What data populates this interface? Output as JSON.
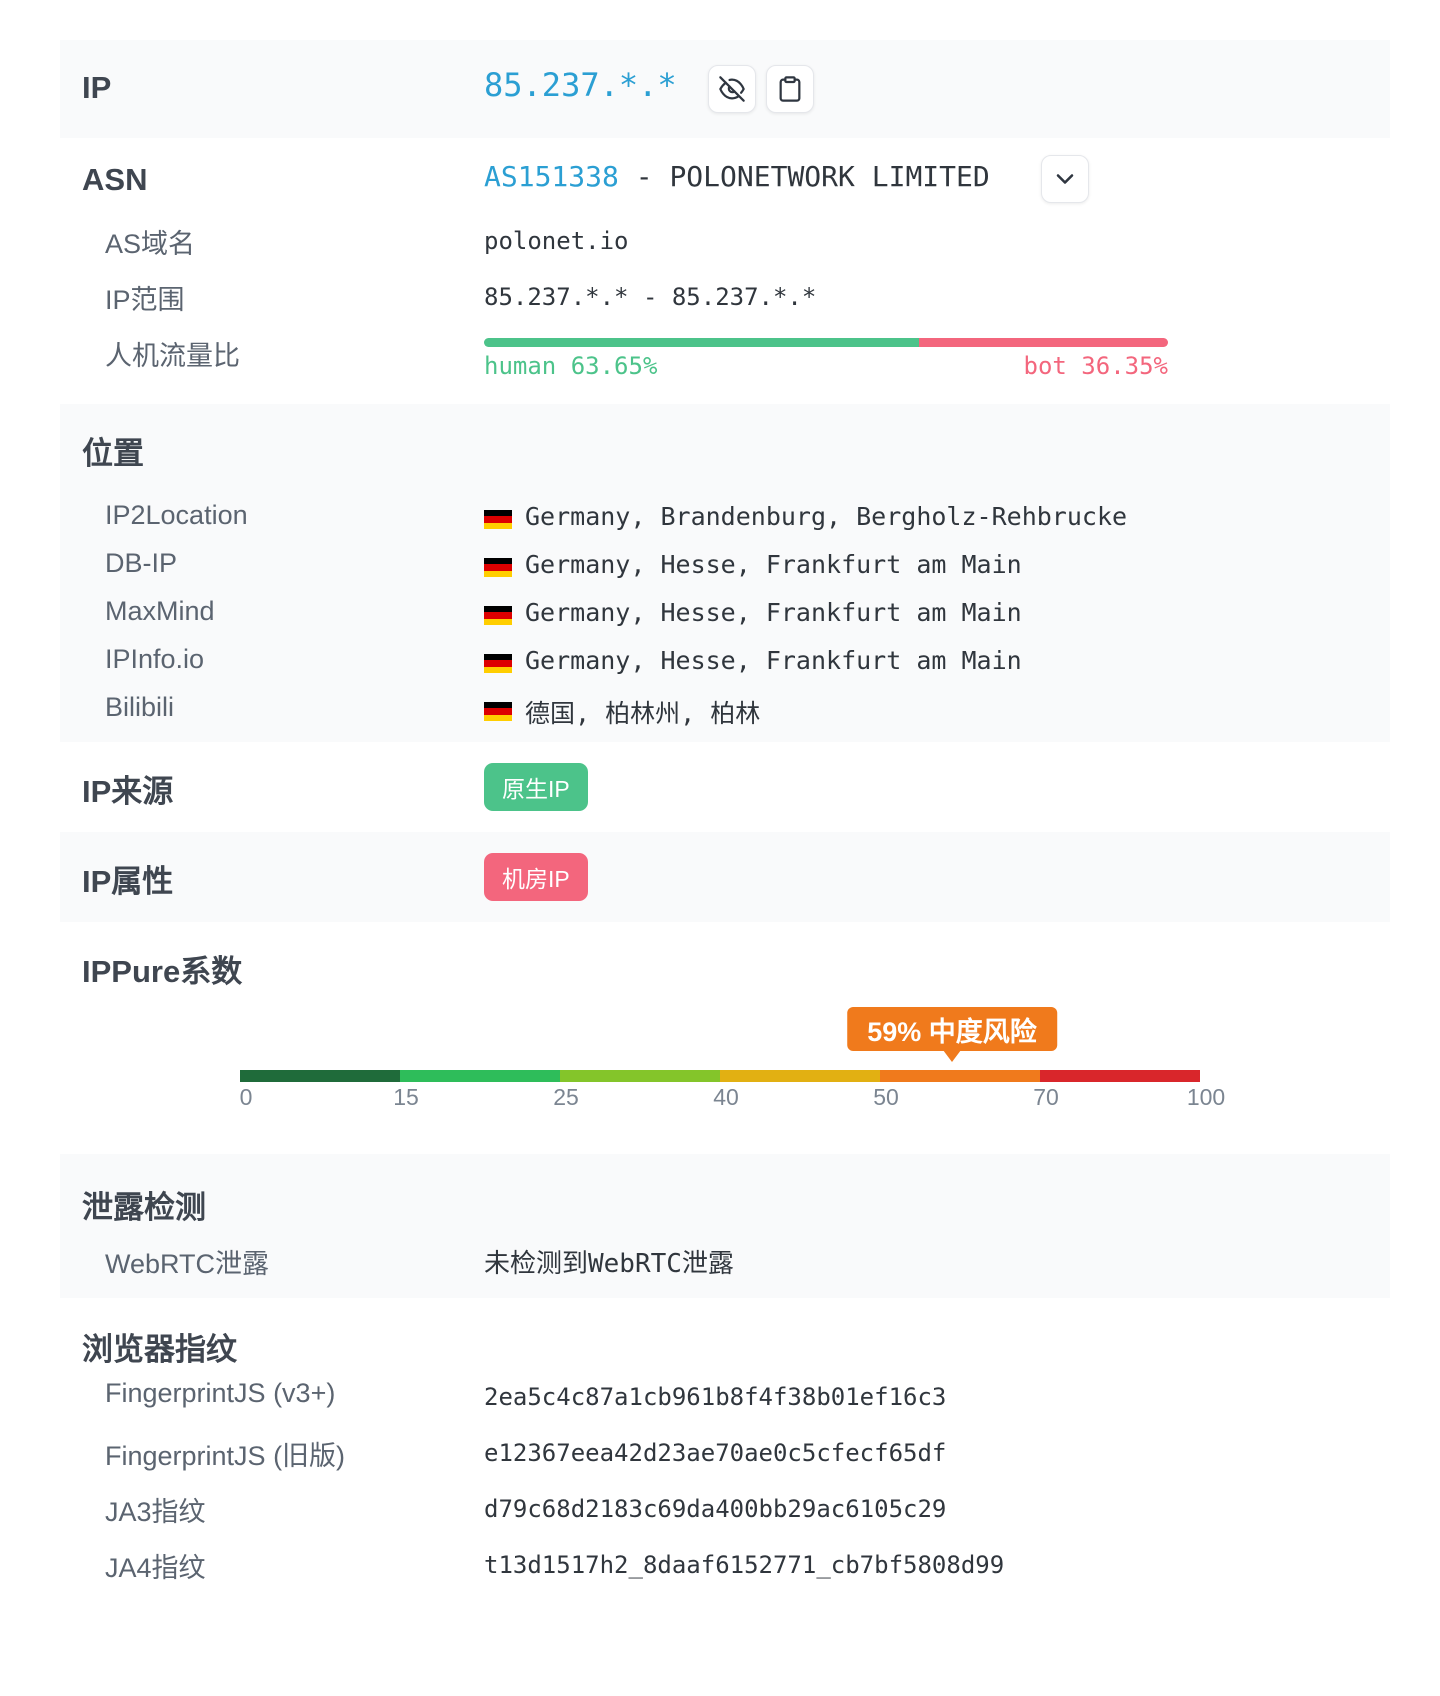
{
  "ip": {
    "label": "IP",
    "value": "85.237.*.*",
    "hide_icon": "eye-off-icon",
    "copy_icon": "clipboard-icon"
  },
  "asn": {
    "label": "ASN",
    "number": "AS151338",
    "separator": " - ",
    "org": "POLONETWORK LIMITED",
    "expand_icon": "chevron-down-icon",
    "domain_label": "AS域名",
    "domain_value": "polonet.io",
    "range_label": "IP范围",
    "range_value": "85.237.*.* - 85.237.*.*",
    "ratio_label": "人机流量比",
    "human_text": "human 63.65%",
    "bot_text": "bot 36.35%",
    "human_fraction": 0.6365,
    "bot_fraction": 0.3635,
    "human_color": "#4cc38a",
    "bot_color": "#f3667d"
  },
  "location": {
    "label": "位置",
    "rows": [
      {
        "source": "IP2Location",
        "value": "Germany, Brandenburg, Bergholz-Rehbrucke"
      },
      {
        "source": "DB-IP",
        "value": "Germany, Hesse, Frankfurt am Main"
      },
      {
        "source": "MaxMind",
        "value": "Germany, Hesse, Frankfurt am Main"
      },
      {
        "source": "IPInfo.io",
        "value": "Germany, Hesse, Frankfurt am Main"
      },
      {
        "source": "Bilibili",
        "value": "德国, 柏林州, 柏林"
      }
    ],
    "flag_colors": [
      "#000000",
      "#dd0000",
      "#ffce00"
    ]
  },
  "source": {
    "label": "IP来源",
    "badge": "原生IP",
    "badge_color": "#4cc38a"
  },
  "attribute": {
    "label": "IP属性",
    "badge": "机房IP",
    "badge_color": "#f3667d"
  },
  "ippure": {
    "label": "IPPure系数",
    "score_text": "59% 中度风险",
    "score": 59,
    "ticks": [
      "0",
      "15",
      "25",
      "40",
      "50",
      "70",
      "100"
    ],
    "segments": [
      {
        "from": 0,
        "to": 15,
        "color": "#1f6b3a"
      },
      {
        "from": 15,
        "to": 25,
        "color": "#2ebd5a"
      },
      {
        "from": 25,
        "to": 40,
        "color": "#84c52a"
      },
      {
        "from": 40,
        "to": 50,
        "color": "#e2b012"
      },
      {
        "from": 50,
        "to": 70,
        "color": "#f07a1c"
      },
      {
        "from": 70,
        "to": 100,
        "color": "#d9262b"
      }
    ],
    "accent": "#f07a1c"
  },
  "leak": {
    "label": "泄露检测",
    "webrtc_label": "WebRTC泄露",
    "webrtc_value": "未检测到WebRTC泄露"
  },
  "fingerprint": {
    "label": "浏览器指纹",
    "rows": [
      {
        "name": "FingerprintJS (v3+)",
        "value": "2ea5c4c87a1cb961b8f4f38b01ef16c3"
      },
      {
        "name": "FingerprintJS (旧版)",
        "value": "e12367eea42d23ae70ae0c5cfecf65df"
      },
      {
        "name": "JA3指纹",
        "value": "d79c68d2183c69da400bb29ac6105c29"
      },
      {
        "name": "JA4指纹",
        "value": "t13d1517h2_8daaf6152771_cb7bf5808d99"
      }
    ]
  }
}
